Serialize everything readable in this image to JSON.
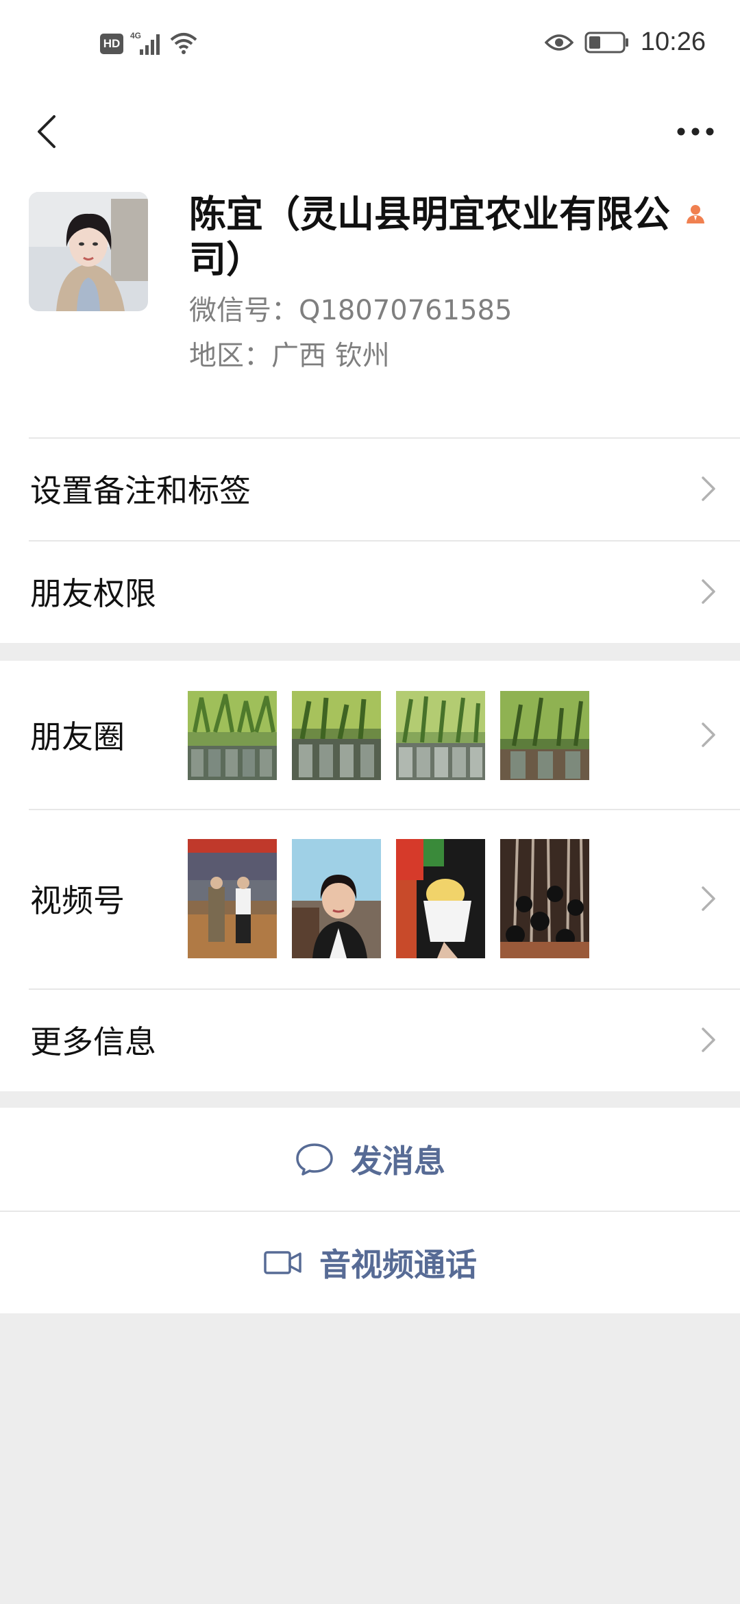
{
  "status_bar": {
    "hd": "HD",
    "network": "4G",
    "time": "10:26",
    "icons": [
      "hd-icon",
      "signal-icon",
      "wifi-icon",
      "eye-icon",
      "battery-icon"
    ]
  },
  "nav": {
    "back_icon": "chevron-left-icon",
    "more_icon": "more-dots-icon"
  },
  "profile": {
    "name": "陈宜（灵山县明宜农业有限公司）",
    "wechat_id": "微信号：Q18070761585",
    "region": "地区：广西  钦州",
    "badge_icon": "person-badge-icon"
  },
  "rows": {
    "remark": "设置备注和标签",
    "permissions": "朋友权限",
    "moments": "朋友圈",
    "channels": "视频号",
    "more_info": "更多信息"
  },
  "moments_thumbs": [
    "plant-seedlings-1",
    "plant-seedlings-2",
    "plant-seedlings-3",
    "plant-seedlings-4"
  ],
  "channels_thumbs": [
    "event-photo",
    "selfie-photo",
    "food-photo",
    "nursery-photo"
  ],
  "actions": {
    "message": "发消息",
    "call": "音视频通话"
  },
  "colors": {
    "link_blue": "#576b95",
    "bg_gray": "#ededed",
    "divider": "#e7e7e7",
    "badge_orange": "#f08050"
  }
}
